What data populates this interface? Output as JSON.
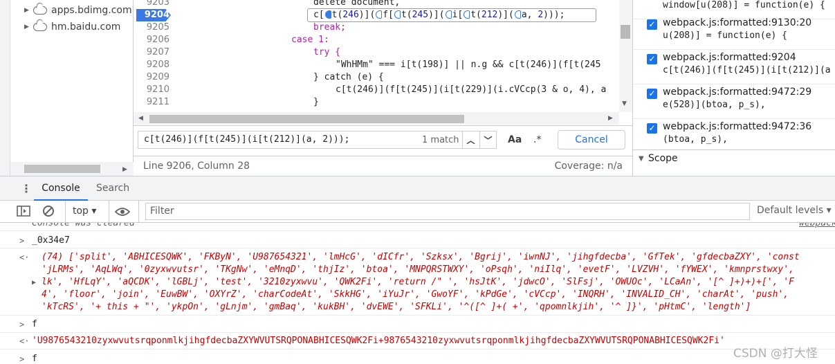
{
  "nav": {
    "items": [
      {
        "label": "apps.bdimg.com"
      },
      {
        "label": "hm.baidu.com"
      }
    ]
  },
  "editor": {
    "lines": [
      {
        "num": "9203",
        "code": "delete document,"
      },
      {
        "num": "9204",
        "code": "c[t(246)](f[t(245)](i[t(212)](a, 2)));"
      },
      {
        "num": "9205",
        "code": "break;"
      },
      {
        "num": "9206",
        "code": "case 1:"
      },
      {
        "num": "9207",
        "code": "try {"
      },
      {
        "num": "9208",
        "code": "\"WhHMm\" === i[t(198)] || n.g && c[t(246)](f[t(245"
      },
      {
        "num": "9209",
        "code": "} catch (e) {"
      },
      {
        "num": "9210",
        "code": "c[t(246)](f[t(245)](i[t(229)](i.cVCcp(3 & o, 4), a"
      },
      {
        "num": "9211",
        "code": "}"
      }
    ],
    "search": {
      "query": "c[t(246)](f[t(245)](i[t(212)](a, 2)));",
      "matches": "1 match",
      "case_label": "Aa",
      "regex_label": ".*",
      "cancel_label": "Cancel"
    },
    "status": {
      "position": "Line 9206, Column 28",
      "coverage": "Coverage: n/a"
    }
  },
  "breakpoints": [
    {
      "file": "window[u(208)] = function(e) {",
      "code": ""
    },
    {
      "file": "webpack.js:formatted:9130:20",
      "code": "u(208)] = function(e) {"
    },
    {
      "file": "webpack.js:formatted:9204",
      "code": "c[t(246)](f[t(245)](i[t(212)](a"
    },
    {
      "file": "webpack.js:formatted:9472:29",
      "code": "e(528)](btoa, p_s),"
    },
    {
      "file": "webpack.js:formatted:9472:36",
      "code": "(btoa, p_s),"
    }
  ],
  "scope": {
    "label": "Scope"
  },
  "drawer": {
    "tabs": [
      {
        "label": "Console"
      },
      {
        "label": "Search"
      }
    ]
  },
  "console_toolbar": {
    "context": "top",
    "filter_placeholder": "Filter",
    "levels": "Default levels"
  },
  "console": {
    "cleared": "Console was cleared",
    "cleared_src": "webpack",
    "cmd1": "_0x34e7",
    "arr_lines": [
      "(74) ['split', 'ABHICESQWK', 'FKByN', 'U987654321', 'lmHcG', 'dICfr', 'Szksx', 'Bgrij', 'iwnNJ', 'jihgfdecba', 'GfTek', 'gfdecbaZXY', 'const",
      "'jLRMs', 'AqLWq', '0zyxwvutsr', 'TKgNw', 'eMnqD', 'thjIz', 'btoa', 'MNPQRSTWXY', 'oPsqh', 'niIlq', 'evetF', 'LVZVH', 'fYWEX', 'kmnprstwxy',",
      "lk', 'HfLqY', 'aQCDK', 'lGBLj', 'test', '3210zyxwvu', 'QWK2Fi', 'return /\" ', 'hsJtK', 'jdwcO', 'SlFsj', 'OWUOc', 'LCaAn', '[^ ]+)+)+[', 'F",
      "4', 'floor', 'join', 'EuwBW', 'OXYrZ', 'charCodeAt', 'SkkHG', 'iYuJr', 'GwoYF', 'kPdGe', 'cVCcp', 'INQRH', 'INVALID_CH', 'charAt', 'push',",
      "'kTcRS', '+ this + \"', 'ykpOn', 'gLnjm', 'gmBaq', 'kukBH', 'dvEWE', 'SFKLi', '^([^ ]+( +', 'qpomnlkjih', '^ ]}', 'pHtmC', 'length']"
    ],
    "cmd2": "f",
    "result2": "'U9876543210zyxwvutsrqponmlkjihgfdecbaZXYWVUTSRQPONABHICESQWK2Fi+9876543210zyxwvutsrqponmlkjihgfdecbaZXYWVUTSRQPONABHICESQWK2Fi'",
    "cmd3": "f"
  },
  "watermark": "CSDN @打大怪"
}
